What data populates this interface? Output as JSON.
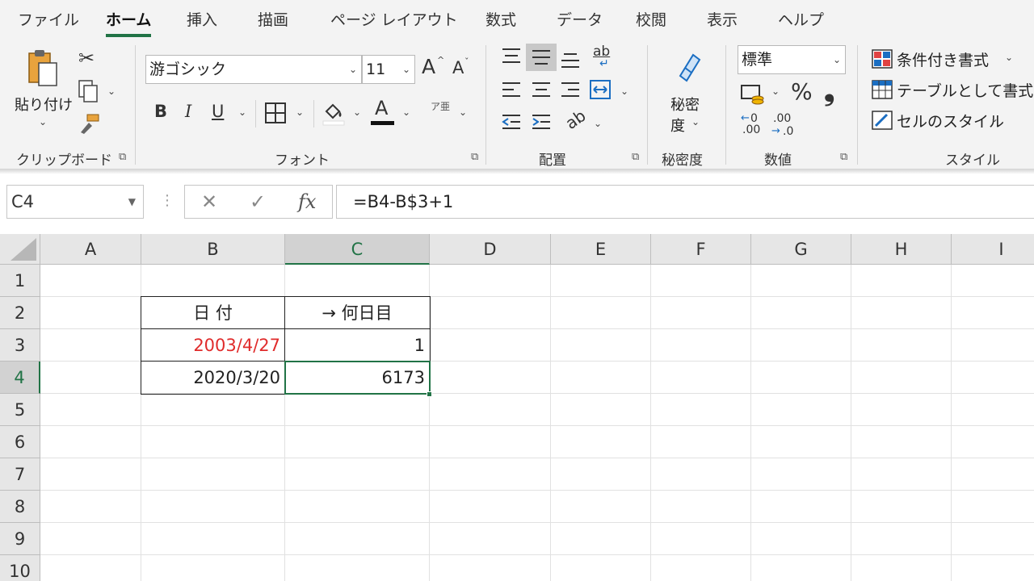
{
  "tabs": [
    "ファイル",
    "ホーム",
    "挿入",
    "描画",
    "ページ レイアウト",
    "数式",
    "データ",
    "校閲",
    "表示",
    "ヘルプ"
  ],
  "active_tab": "ホーム",
  "ribbon": {
    "clipboard": {
      "paste_label": "貼り付け",
      "group_label": "クリップボード"
    },
    "font": {
      "font_name": "游ゴシック",
      "font_size": "11",
      "bold": "B",
      "italic": "I",
      "underline": "U",
      "grow": "A",
      "shrink": "A",
      "color_a": "A",
      "phonetic": "ア亜",
      "group_label": "フォント"
    },
    "alignment": {
      "wrap": "ab",
      "group_label": "配置"
    },
    "sensitivity": {
      "label_line1": "秘密",
      "label_line2": "度",
      "group_label": "秘密度"
    },
    "number": {
      "format": "標準",
      "percent": "%",
      "comma": "❟",
      "inc_decimal": ".00",
      "dec_decimal": ".00",
      "group_label": "数値"
    },
    "styles": {
      "conditional": "条件付き書式",
      "table": "テーブルとして書式設定",
      "cell_styles": "セルのスタイル",
      "group_label": "スタイル"
    }
  },
  "formula_bar": {
    "name_box": "C4",
    "cancel": "✕",
    "enter": "✓",
    "fx": "fx",
    "formula": "=B4-B$3+1"
  },
  "colors": {
    "accent": "#217346",
    "red_text": "#e02b2b"
  },
  "columns": [
    "A",
    "B",
    "C",
    "D",
    "E",
    "F",
    "G",
    "H",
    "I"
  ],
  "rows": [
    "1",
    "2",
    "3",
    "4",
    "5",
    "6",
    "7",
    "8",
    "9",
    "10"
  ],
  "selected_cell": "C4",
  "cells": {
    "B2": "日 付",
    "C2": "→ 何日目",
    "B3": "2003/4/27",
    "C3": "1",
    "B4": "2020/3/20",
    "C4": "6173"
  }
}
